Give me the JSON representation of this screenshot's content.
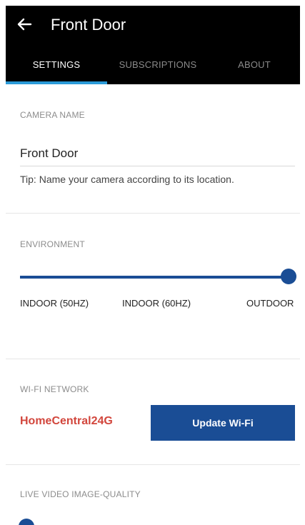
{
  "header": {
    "title": "Front Door",
    "back_icon": "arrow-left-icon"
  },
  "tabs": [
    {
      "label": "SETTINGS",
      "active": true
    },
    {
      "label": "SUBSCRIPTIONS",
      "active": false
    },
    {
      "label": "ABOUT",
      "active": false
    }
  ],
  "camera_name": {
    "label": "CAMERA NAME",
    "value": "Front Door",
    "tip": "Tip: Name your camera according to its location."
  },
  "environment": {
    "label": "ENVIRONMENT",
    "options": [
      "INDOOR (50HZ)",
      "INDOOR (60HZ)",
      "OUTDOOR"
    ],
    "selected": "OUTDOOR"
  },
  "wifi": {
    "label": "WI-FI NETWORK",
    "network_name": "HomeCentral24G",
    "update_button": "Update Wi-Fi"
  },
  "live_video": {
    "label": "LIVE VIDEO IMAGE-QUALITY"
  },
  "colors": {
    "header_bg": "#000000",
    "tab_indicator": "#2b9ad8",
    "accent": "#1a4d95",
    "wifi_name": "#d2463c"
  }
}
